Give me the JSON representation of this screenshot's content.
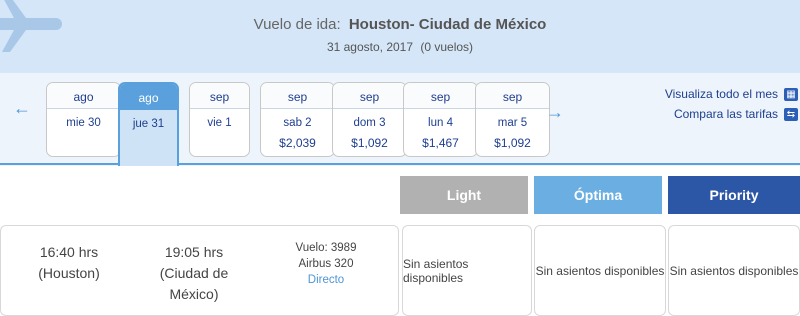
{
  "header": {
    "label": "Vuelo de ida:",
    "route": "Houston- Ciudad de México",
    "date": "31 agosto, 2017",
    "flight_count": "(0 vuelos)"
  },
  "nav": {
    "prev_icon": "arrow-left-icon",
    "next_icon": "arrow-right-icon"
  },
  "days": [
    {
      "month": "ago",
      "day": "mie 30",
      "price": ""
    },
    {
      "month": "ago",
      "day": "jue 31",
      "price": "",
      "selected": true
    },
    {
      "month": "sep",
      "day": "vie 1",
      "price": ""
    },
    {
      "month": "sep",
      "day": "sab 2",
      "price": "$2,039"
    },
    {
      "month": "sep",
      "day": "dom 3",
      "price": "$1,092"
    },
    {
      "month": "sep",
      "day": "lun 4",
      "price": "$1,467"
    },
    {
      "month": "sep",
      "day": "mar 5",
      "price": "$1,092"
    }
  ],
  "links": {
    "month": "Visualiza todo el mes",
    "compare": "Compara las tarifas"
  },
  "fares": {
    "light": "Light",
    "optima": "Óptima",
    "priority": "Priority"
  },
  "flight": {
    "dep_time": "16:40 hrs",
    "dep_city": "(Houston)",
    "arr_time": "19:05 hrs",
    "arr_city": "(Ciudad de México)",
    "flight_no": "Vuelo: 3989",
    "aircraft": "Airbus 320",
    "type": "Directo"
  },
  "availability": {
    "light": "Sin asientos disponibles",
    "optima": "Sin asientos disponibles",
    "priority": "Sin asientos disponibles"
  },
  "colors": {
    "accent": "#5aa0dc",
    "header_bg": "#d4e6f7",
    "priority": "#2c56a6",
    "light": "#b1b1b1",
    "optima": "#6aaee2"
  }
}
